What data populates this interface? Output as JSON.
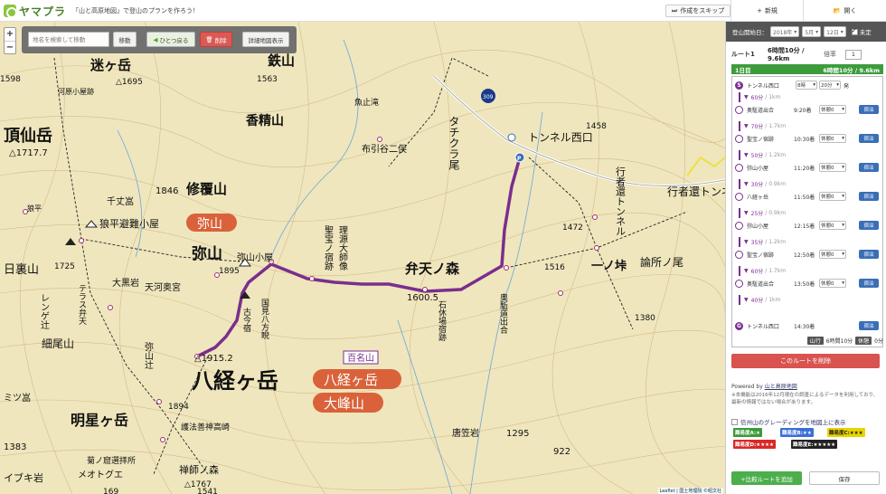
{
  "header": {
    "logo_text": "ヤマプラ",
    "tagline": "「山と高原地図」で登山のプランを作ろう！",
    "skip_label": "作成をスキップ",
    "new_label": "新規",
    "open_label": "開く"
  },
  "map_toolbar": {
    "search_placeholder": "地名を検索して移動",
    "move_label": "移動",
    "undo_label": "ひとつ戻る",
    "delete_label": "削除",
    "detail_label": "詳細地図表示"
  },
  "zoom": {
    "in": "+",
    "out": "−"
  },
  "map_labels": {
    "place_labels": [
      "迷ヶ岳",
      "△1695",
      "河原小屋跡",
      "1598",
      "鉄山",
      "1563",
      "香精山",
      "魚止滝",
      "布引谷二俣",
      "タチクラ尾",
      "トンネル西口",
      "1458",
      "行者還トンネル",
      "行者還トンネル東口",
      "頂仙岳",
      "△1717.7",
      "1846",
      "修覆山",
      "千丈嵓",
      "狼平避難小屋",
      "狼平",
      "1472",
      "聖宝ノ宿跡",
      "理源大師像",
      "弥山",
      "1895",
      "弥山小屋",
      "日裏山",
      "1725",
      "レンゲ辻",
      "テラス弁天",
      "大黒岩",
      "天河奥宮",
      "国見八方睨",
      "古今宿",
      "弁天ノ森",
      "1600.5",
      "石休場宿跡",
      "奥駈道出合",
      "1516",
      "一ノ垰",
      "論所ノ尾",
      "1380",
      "細尾山",
      "△1915.2",
      "弥山辻",
      "八経ヶ岳",
      "明星ヶ岳",
      "1894",
      "ミツ嵓",
      "護法善神高崎",
      "菊ノ窟選拝所",
      "1383",
      "唐笠岩",
      "1295",
      "922",
      "禅師ノ森",
      "△1767",
      "イブキ岩",
      "メオトグエ",
      "169",
      "1541"
    ],
    "badge_hyakumeizan": "百名山",
    "badge_hakkyo": "八経ヶ岳",
    "badge_omine": "大峰山",
    "badge_misen": "弥山",
    "attribution": "Leaflet | 国土地理院 ©昭文社"
  },
  "sidebar": {
    "date_label": "登山開始日：",
    "year": "2018年",
    "month": "5月",
    "day": "12日",
    "undecided": "未定",
    "route_name": "ルート1",
    "route_total": "6時間10分 / 9.6km",
    "pace_label": "倍率",
    "pace_value": "1",
    "day_label": "1日目",
    "day_total": "6時間10分 / 9.6km",
    "start_name": "トンネル西口",
    "start_hour": "8時",
    "start_min": "20分",
    "start_suffix": "発",
    "points": [
      {
        "name": "奥駈道出合",
        "time": "9:20着",
        "rest": "休憩0",
        "camp": "宿泊"
      },
      {
        "name": "聖宝ノ宿跡",
        "time": "10:30着",
        "rest": "休憩0",
        "camp": "宿泊"
      },
      {
        "name": "弥山小屋",
        "time": "11:20着",
        "rest": "休憩0",
        "camp": "宿泊"
      },
      {
        "name": "八経ヶ岳",
        "time": "11:50着",
        "rest": "休憩0",
        "camp": "宿泊"
      },
      {
        "name": "弥山小屋",
        "time": "12:15着",
        "rest": "休憩0",
        "camp": "宿泊"
      },
      {
        "name": "聖宝ノ宿跡",
        "time": "12:50着",
        "rest": "休憩0",
        "camp": "宿泊"
      },
      {
        "name": "奥駈道出合",
        "time": "13:50着",
        "rest": "休憩0",
        "camp": "宿泊"
      }
    ],
    "end_name": "トンネル西口",
    "end_time": "14:30着",
    "end_camp": "宿泊",
    "legs": [
      {
        "dur": "60分",
        "dist": "1km"
      },
      {
        "dur": "70分",
        "dist": "1.7km"
      },
      {
        "dur": "50分",
        "dist": "1.2km"
      },
      {
        "dur": "30分",
        "dist": "0.9km"
      },
      {
        "dur": "25分",
        "dist": "0.9km"
      },
      {
        "dur": "35分",
        "dist": "1.2km"
      },
      {
        "dur": "60分",
        "dist": "1.7km"
      },
      {
        "dur": "40分",
        "dist": "1km"
      }
    ],
    "summary_walk_tag": "山行",
    "summary_walk": "6時間10分",
    "summary_rest_tag": "休憩",
    "summary_rest": "0分",
    "delete_route": "このルートを削除",
    "powered_prefix": "Powered by ",
    "powered_link": "山と高原地図",
    "note": "※本機能は2016年12月現在の調査によるデータを利用しており、最新の情報ではない場合があります。",
    "grading_toggle": "信州山のグレーディングを地図上に表示",
    "grades": [
      "難易度A:★",
      "難易度B:★★",
      "難易度C:★★★",
      "難易度D:★★★★",
      "難易度E:★★★★★"
    ],
    "grade_colors": [
      "#3a9a3a",
      "#3a6fd8",
      "#e8d400",
      "#d82828",
      "#222222"
    ],
    "compare_label": "+比較ルートを追加",
    "save_label": "保存"
  },
  "colors": {
    "route": "#7a2e8e",
    "map_bg": "#efe6bd",
    "accent_green": "#3c9c3c",
    "danger": "#d9534f"
  }
}
